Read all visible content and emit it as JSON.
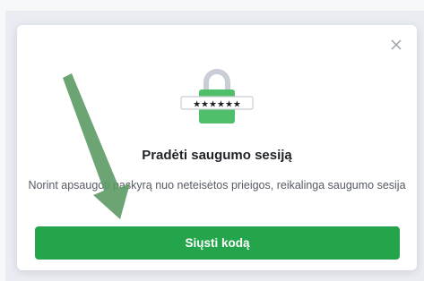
{
  "dialog": {
    "title": "Pradėti saugumo sesiją",
    "description": "Norint apsaugoti paskyrą nuo neteisėtos prieigos, reikalinga saugumo sesija",
    "send_button_label": "Siųsti kodą",
    "password_mask": "★★★★★★"
  },
  "icons": {
    "close": "close-icon",
    "lock": "padlock-password-icon"
  },
  "colors": {
    "accent_green": "#24a54b",
    "lock_green": "#4fbf6c",
    "arrow_green": "#5d9a64"
  }
}
